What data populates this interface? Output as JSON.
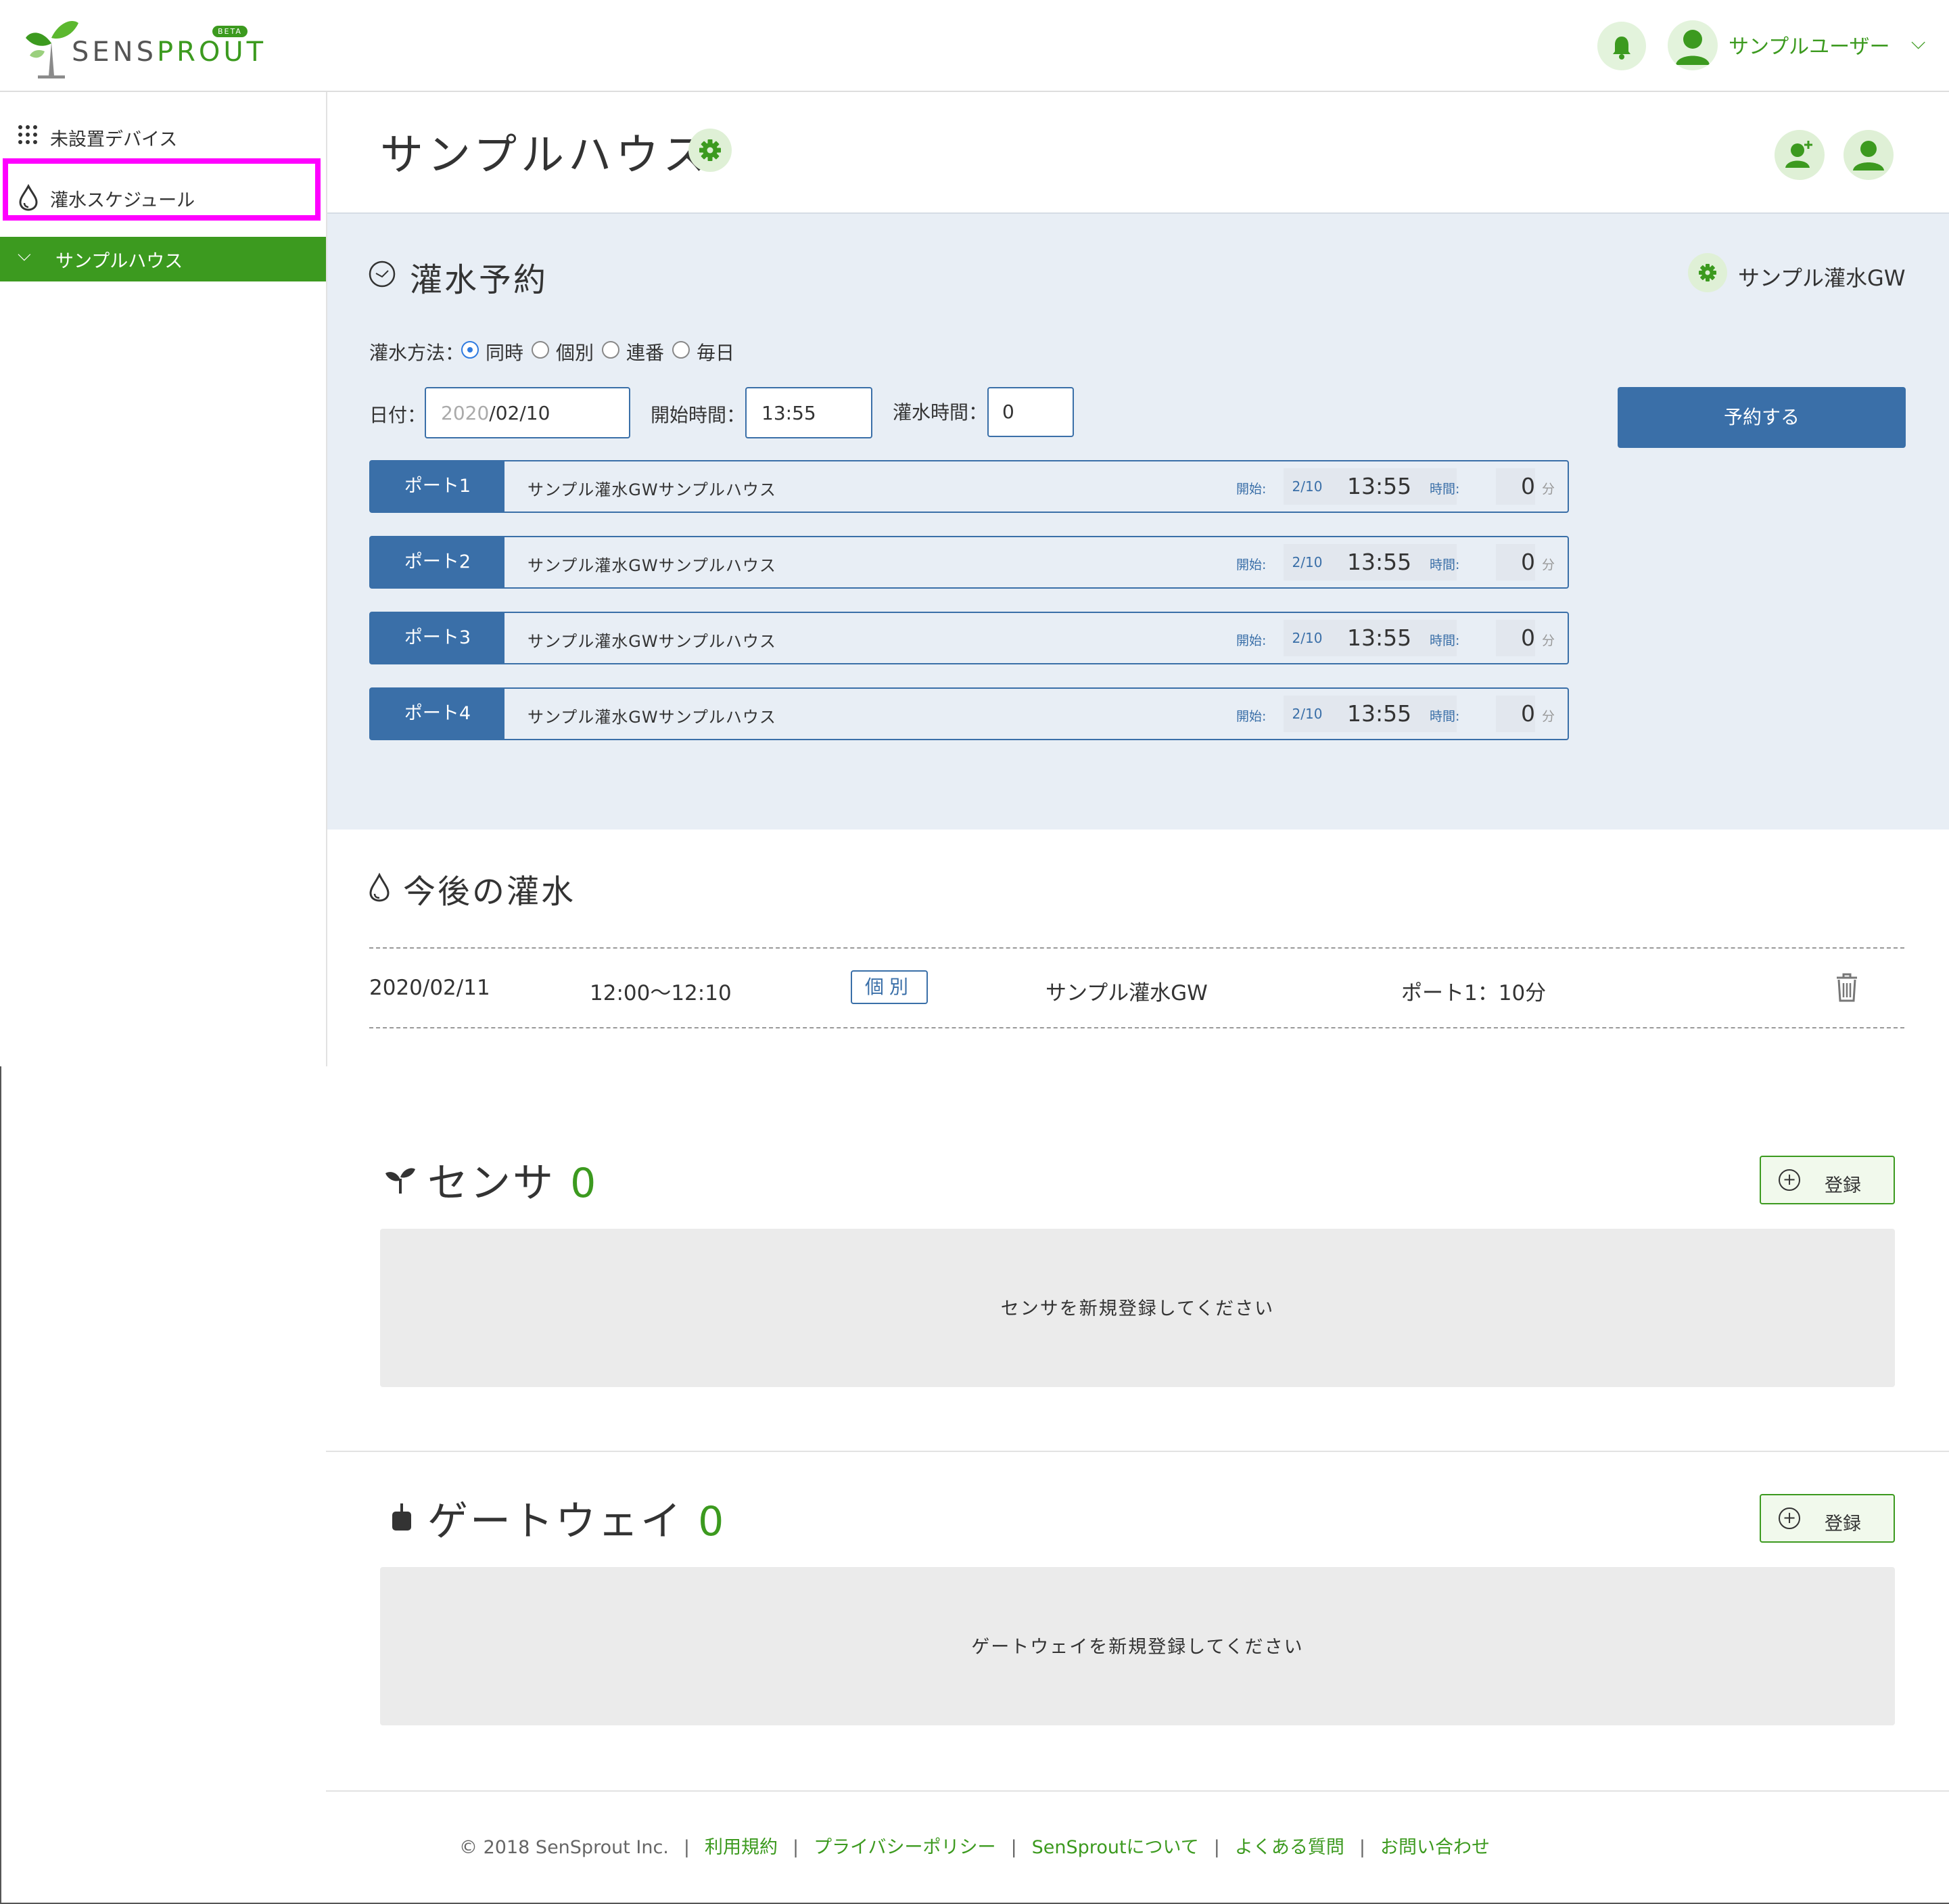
{
  "header": {
    "logo_text_a": "SENS",
    "logo_text_b": "PROUT",
    "beta": "BETA",
    "user_name": "サンプルユーザー",
    "chevron": "⌵"
  },
  "sidebar": {
    "items": [
      {
        "label": "未設置デバイス",
        "icon": "grid-icon"
      },
      {
        "label": "灌水スケジュール",
        "icon": "water-drop-icon"
      }
    ],
    "house": {
      "label": "サンプルハウス",
      "chevron": "⌵"
    }
  },
  "page": {
    "title": "サンプルハウス"
  },
  "reservation": {
    "title": "灌水予約",
    "gateway_name": "サンプル灌水GW",
    "method_label": "灌水方法：",
    "methods": [
      "同時",
      "個別",
      "連番",
      "毎日"
    ],
    "selected_method": "同時",
    "date_label": "日付：",
    "date_placeholder": "2020",
    "date_value": "/02/10",
    "start_label": "開始時間：",
    "start_value": "13:55",
    "duration_label": "灌水時間：",
    "duration_value": "0",
    "submit_label": "予約する",
    "ports": [
      {
        "name": "ポート1",
        "desc": "サンプル灌水GWサンプルハウス",
        "start_label": "開始:",
        "date": "2/10",
        "time": "13:55",
        "duration_label": "時間:",
        "duration": "0",
        "unit": "分"
      },
      {
        "name": "ポート2",
        "desc": "サンプル灌水GWサンプルハウス",
        "start_label": "開始:",
        "date": "2/10",
        "time": "13:55",
        "duration_label": "時間:",
        "duration": "0",
        "unit": "分"
      },
      {
        "name": "ポート3",
        "desc": "サンプル灌水GWサンプルハウス",
        "start_label": "開始:",
        "date": "2/10",
        "time": "13:55",
        "duration_label": "時間:",
        "duration": "0",
        "unit": "分"
      },
      {
        "name": "ポート4",
        "desc": "サンプル灌水GWサンプルハウス",
        "start_label": "開始:",
        "date": "2/10",
        "time": "13:55",
        "duration_label": "時間:",
        "duration": "0",
        "unit": "分"
      }
    ]
  },
  "upcoming": {
    "title": "今後の灌水",
    "rows": [
      {
        "date": "2020/02/11",
        "time": "12:00〜12:10",
        "mode": "個別",
        "gateway": "サンプル灌水GW",
        "detail": "ポート1：10分"
      }
    ]
  },
  "sensor": {
    "title": "センサ",
    "count": "0",
    "register_label": "登録",
    "plus": "+",
    "empty_message": "センサを新規登録してください"
  },
  "gateway": {
    "title": "ゲートウェイ",
    "count": "0",
    "register_label": "登録",
    "plus": "+",
    "empty_message": "ゲートウェイを新規登録してください"
  },
  "footer": {
    "copyright": "© 2018 SenSprout Inc.",
    "separator": "|",
    "links": [
      "利用規約",
      "プライバシーポリシー",
      "SenSproutについて",
      "よくある質問",
      "お問い合わせ"
    ]
  },
  "colors": {
    "brand_green": "#3c9a1f",
    "accent_blue": "#3a6fa8",
    "highlight": "#ff00ff",
    "panel_bg": "#e8eef5"
  }
}
